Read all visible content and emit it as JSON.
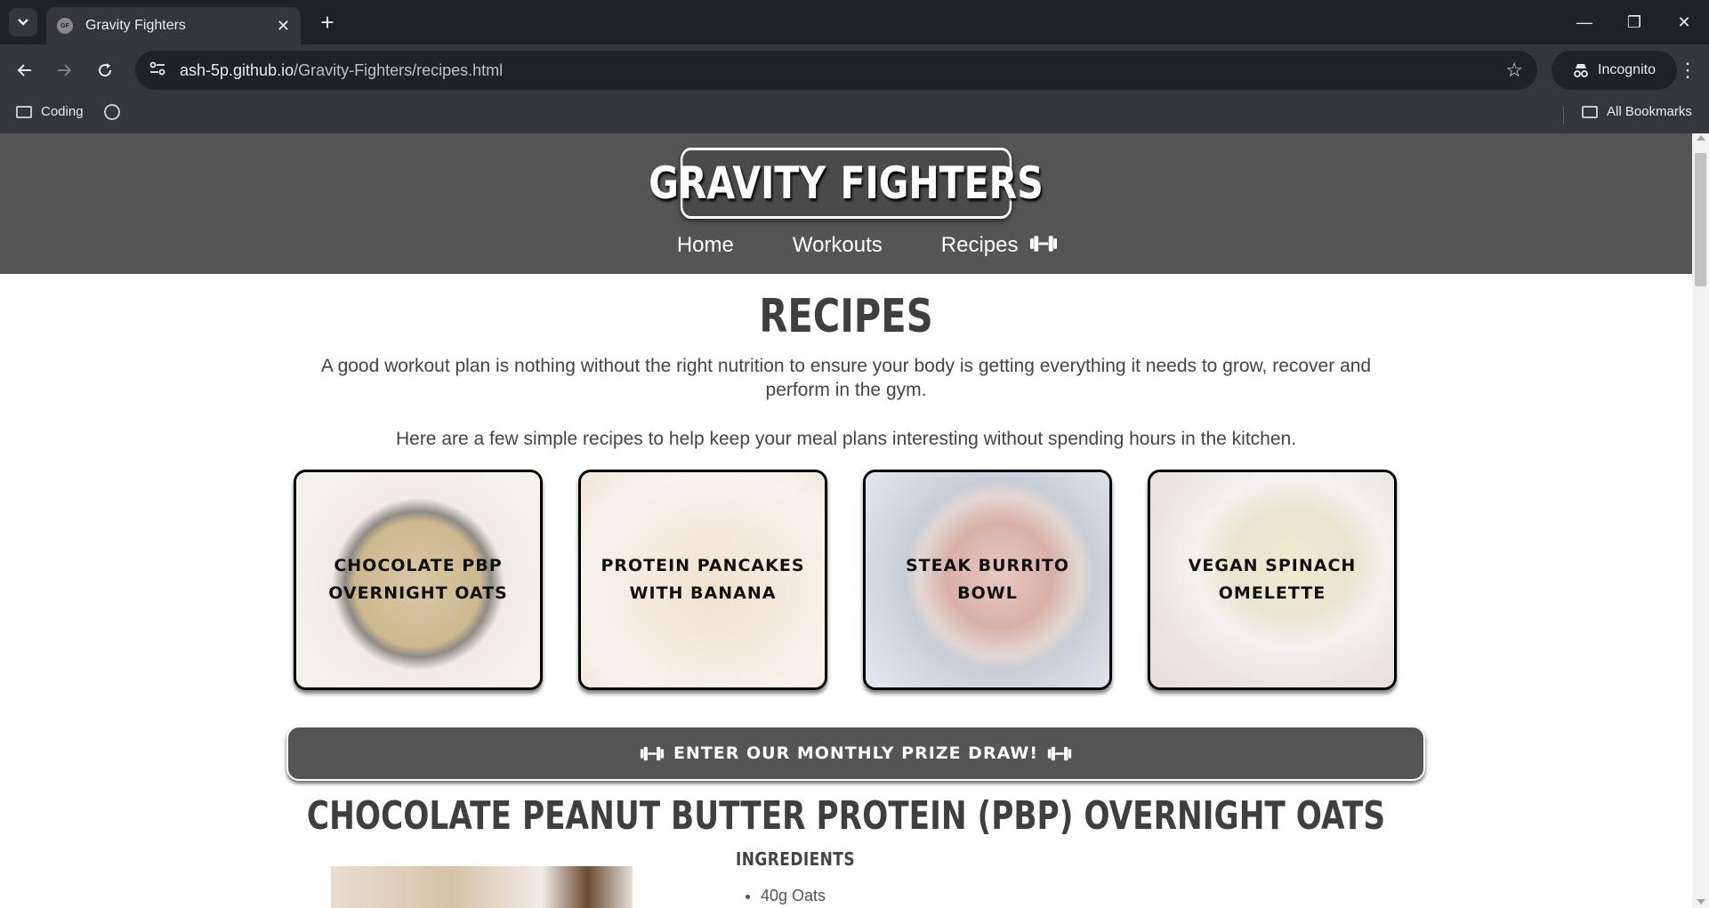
{
  "browser": {
    "tab_title": "Gravity Fighters",
    "url_host": "ash-5p.github.io",
    "url_path": "/Gravity-Fighters/recipes.html",
    "incognito_label": "Incognito",
    "bookmarks": [
      {
        "label": "Coding",
        "icon": "folder-icon"
      },
      {
        "label": "",
        "icon": "globe-icon"
      }
    ],
    "all_bookmarks_label": "All Bookmarks",
    "favicon_text": "GF"
  },
  "site": {
    "logo_left": "GRAVITY",
    "logo_right": "FIGHTERS",
    "nav": [
      {
        "label": "Home"
      },
      {
        "label": "Workouts"
      },
      {
        "label": "Recipes"
      }
    ]
  },
  "main": {
    "title": "RECIPES",
    "intro": "A good workout plan is nothing without the right nutrition to ensure your body is getting everything it needs to grow, recover and perform in the gym.",
    "intro2": "Here are a few simple recipes to help keep your meal plans interesting without spending hours in the kitchen.",
    "cards": [
      {
        "label": "CHOCOLATE PBP OVERNIGHT OATS"
      },
      {
        "label": "PROTEIN PANCAKES WITH BANANA"
      },
      {
        "label": "STEAK BURRITO BOWL"
      },
      {
        "label": "VEGAN SPINACH OMELETTE"
      }
    ],
    "prize_label": "ENTER OUR MONTHLY PRIZE DRAW!",
    "section_title": "CHOCOLATE PEANUT BUTTER PROTEIN (PBP) OVERNIGHT OATS",
    "ingredients_heading": "INGREDIENTS",
    "ingredients": [
      "40g Oats"
    ]
  },
  "colors": {
    "header_bg": "#555555",
    "title_text": "#3f3f3f",
    "chrome_bg": "#202124",
    "chrome_toolbar": "#35363a"
  }
}
